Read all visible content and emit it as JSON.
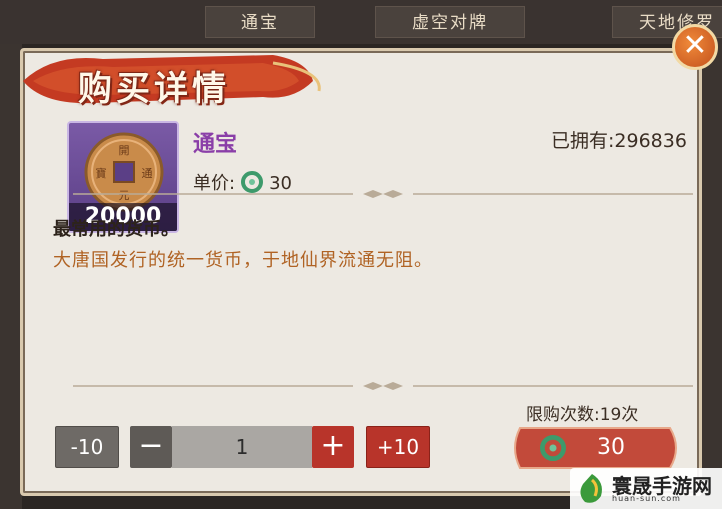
{
  "background_tabs": [
    "通宝",
    "虚空对牌",
    "天地修罗"
  ],
  "dialog": {
    "title": "购买详情",
    "close_symbol": "✕"
  },
  "item": {
    "name": "通宝",
    "icon_quantity": "20000",
    "unit_price_label": "单价:",
    "unit_price": "30",
    "owned_label": "已拥有:",
    "owned_value": "296836",
    "description_1": "最常用的货币。",
    "description_2": "大唐国发行的统一货币，于地仙界流通无阻。"
  },
  "purchase": {
    "limit_label": "限购次数:",
    "limit_value": "19次",
    "minus10_label": "-10",
    "minus_label": "−",
    "quantity": "1",
    "plus_label": "+",
    "plus10_label": "+10",
    "total_price": "30"
  },
  "watermark": {
    "text": "寰晟手游网",
    "url": "huan-sun.com"
  },
  "colors": {
    "dialog_bg": "#ede9e2",
    "item_name": "#8a3ea8",
    "lore_text": "#b06324",
    "red_button": "#b8342a",
    "jade": "#3d9a6b"
  },
  "icons": [
    "coin-icon",
    "jade-currency-icon",
    "close-icon"
  ]
}
